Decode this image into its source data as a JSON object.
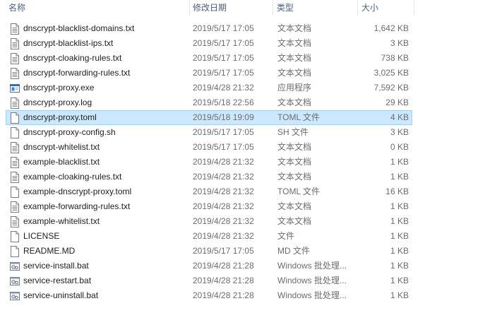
{
  "columns": {
    "name": "名称",
    "date": "修改日期",
    "type": "类型",
    "size": "大小"
  },
  "files": [
    {
      "name": "dnscrypt-blacklist-domains.txt",
      "date": "2019/5/17 17:05",
      "type": "文本文档",
      "size": "1,642 KB",
      "icon": "text-file-icon"
    },
    {
      "name": "dnscrypt-blacklist-ips.txt",
      "date": "2019/5/17 17:05",
      "type": "文本文档",
      "size": "3 KB",
      "icon": "text-file-icon"
    },
    {
      "name": "dnscrypt-cloaking-rules.txt",
      "date": "2019/5/17 17:05",
      "type": "文本文档",
      "size": "738 KB",
      "icon": "text-file-icon"
    },
    {
      "name": "dnscrypt-forwarding-rules.txt",
      "date": "2019/5/17 17:05",
      "type": "文本文档",
      "size": "3,025 KB",
      "icon": "text-file-icon"
    },
    {
      "name": "dnscrypt-proxy.exe",
      "date": "2019/4/28 21:32",
      "type": "应用程序",
      "size": "7,592 KB",
      "icon": "exe-file-icon"
    },
    {
      "name": "dnscrypt-proxy.log",
      "date": "2019/5/18 22:56",
      "type": "文本文档",
      "size": "29 KB",
      "icon": "text-file-icon"
    },
    {
      "name": "dnscrypt-proxy.toml",
      "date": "2019/5/18 19:09",
      "type": "TOML 文件",
      "size": "4 KB",
      "icon": "blank-file-icon",
      "selected": true
    },
    {
      "name": "dnscrypt-proxy-config.sh",
      "date": "2019/5/17 17:05",
      "type": "SH 文件",
      "size": "3 KB",
      "icon": "blank-file-icon"
    },
    {
      "name": "dnscrypt-whitelist.txt",
      "date": "2019/5/17 17:05",
      "type": "文本文档",
      "size": "0 KB",
      "icon": "text-file-icon"
    },
    {
      "name": "example-blacklist.txt",
      "date": "2019/4/28 21:32",
      "type": "文本文档",
      "size": "1 KB",
      "icon": "text-file-icon"
    },
    {
      "name": "example-cloaking-rules.txt",
      "date": "2019/4/28 21:32",
      "type": "文本文档",
      "size": "1 KB",
      "icon": "text-file-icon"
    },
    {
      "name": "example-dnscrypt-proxy.toml",
      "date": "2019/4/28 21:32",
      "type": "TOML 文件",
      "size": "16 KB",
      "icon": "blank-file-icon"
    },
    {
      "name": "example-forwarding-rules.txt",
      "date": "2019/4/28 21:32",
      "type": "文本文档",
      "size": "1 KB",
      "icon": "text-file-icon"
    },
    {
      "name": "example-whitelist.txt",
      "date": "2019/4/28 21:32",
      "type": "文本文档",
      "size": "1 KB",
      "icon": "text-file-icon"
    },
    {
      "name": "LICENSE",
      "date": "2019/4/28 21:32",
      "type": "文件",
      "size": "1 KB",
      "icon": "blank-file-icon"
    },
    {
      "name": "README.MD",
      "date": "2019/5/17 17:05",
      "type": "MD 文件",
      "size": "1 KB",
      "icon": "blank-file-icon"
    },
    {
      "name": "service-install.bat",
      "date": "2019/4/28 21:28",
      "type": "Windows 批处理...",
      "size": "1 KB",
      "icon": "batch-file-icon"
    },
    {
      "name": "service-restart.bat",
      "date": "2019/4/28 21:28",
      "type": "Windows 批处理...",
      "size": "1 KB",
      "icon": "batch-file-icon"
    },
    {
      "name": "service-uninstall.bat",
      "date": "2019/4/28 21:28",
      "type": "Windows 批处理...",
      "size": "1 KB",
      "icon": "batch-file-icon"
    }
  ],
  "colors": {
    "selection_bg": "#cce8ff",
    "selection_border": "#99d1ff",
    "header_text": "#4c607a",
    "secondary_text": "#6d6d6d"
  }
}
